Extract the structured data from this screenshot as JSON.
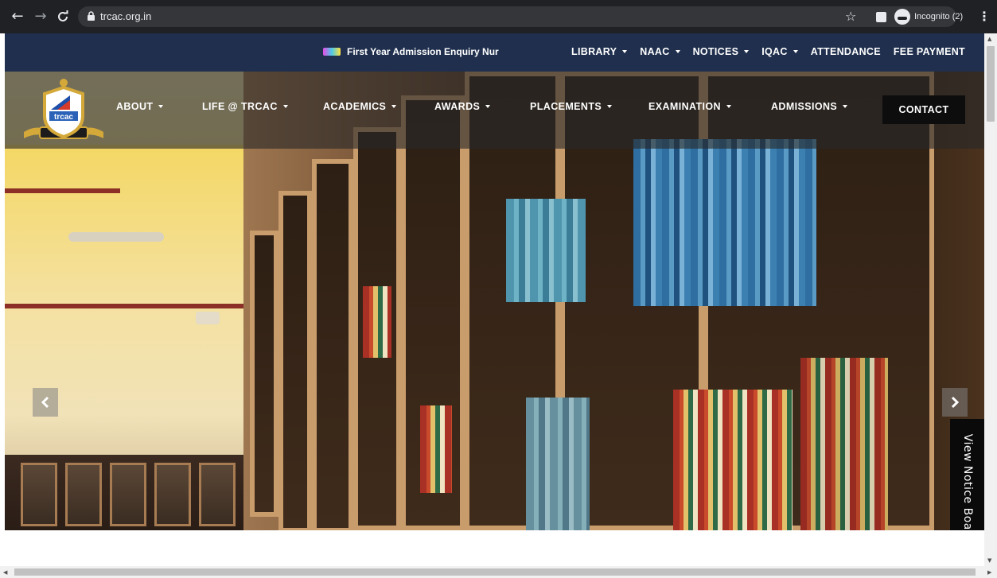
{
  "browser": {
    "url": "trcac.org.in",
    "profile_label": "Incognito (2)",
    "icons": [
      "back-arrow-icon",
      "forward-arrow-icon",
      "reload-icon",
      "lock-icon",
      "star-icon",
      "side-panel-icon",
      "incognito-icon",
      "kebab-menu-icon"
    ]
  },
  "topbar": {
    "ticker_text": "First Year Admission Enquiry Nur",
    "menu": [
      {
        "label": "LIBRARY",
        "dropdown": true
      },
      {
        "label": "NAAC",
        "dropdown": true
      },
      {
        "label": "NOTICES",
        "dropdown": true
      },
      {
        "label": "IQAC",
        "dropdown": true
      },
      {
        "label": "ATTENDANCE",
        "dropdown": false
      },
      {
        "label": "FEE PAYMENT",
        "dropdown": false
      }
    ]
  },
  "mainnav": {
    "logo_text": "trcac",
    "items": [
      {
        "label": "ABOUT"
      },
      {
        "label": "LIFE @ TRCAC"
      },
      {
        "label": "ACADEMICS"
      },
      {
        "label": "AWARDS"
      },
      {
        "label": "PLACEMENTS"
      },
      {
        "label": "EXAMINATION"
      },
      {
        "label": "ADMISSIONS"
      }
    ],
    "contact_label": "CONTACT"
  },
  "hero": {
    "prev_icon": "chevron-left-icon",
    "next_icon": "chevron-right-icon"
  },
  "notice_tab": {
    "label": "View Notice Board"
  },
  "colors": {
    "topbar_bg": "#1f2f4d",
    "chrome_bg": "#202124",
    "contact_bg": "#0d0d0d",
    "logo_gold": "#d4a93a"
  }
}
